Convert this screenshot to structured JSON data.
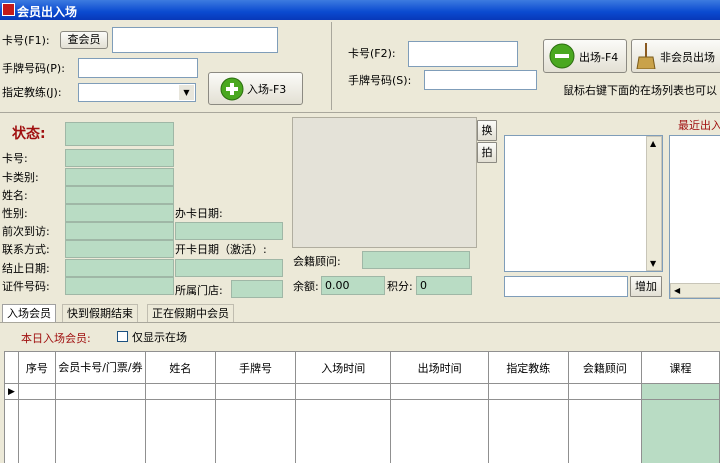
{
  "window": {
    "title": "会员出入场"
  },
  "entry": {
    "card_label": "卡号(F1):",
    "lookup_btn": "查会员",
    "card_value": "",
    "tag_label": "手牌号码(P):",
    "tag_value": "",
    "coach_label": "指定教练(J):",
    "coach_value": "",
    "enter_btn": "入场-F3"
  },
  "exit": {
    "card_label": "卡号(F2):",
    "card_value": "",
    "tag_label": "手牌号码(S):",
    "tag_value": "",
    "exit_btn": "出场-F4",
    "nonmember_btn": "非会员出场",
    "hint": "鼠标右键下面的在场列表也可以"
  },
  "status": {
    "title": "状态:",
    "fields": {
      "card_no": "卡号:",
      "card_type": "卡类别:",
      "name": "姓名:",
      "gender": "性别:",
      "last_visit": "前次到访:",
      "contact": "联系方式:",
      "end_date": "结止日期:",
      "id_no": "证件号码:",
      "issue_date": "办卡日期:",
      "activate_date": "开卡日期（激活）:",
      "store": "所属门店:"
    }
  },
  "photo": {
    "switch_btn": "换",
    "shoot_btn": "拍"
  },
  "account": {
    "advisor_label": "会籍顾问:",
    "balance_label": "余额:",
    "balance_value": "0.00",
    "points_label": "积分:",
    "points_value": "0"
  },
  "list_panel": {
    "add_btn": "增加"
  },
  "recent": {
    "title": "最近出入"
  },
  "tabs": [
    {
      "label": "入场会员",
      "active": true
    },
    {
      "label": "快到假期结束",
      "active": false
    },
    {
      "label": "正在假期中会员",
      "active": false
    }
  ],
  "today": {
    "label": "本日入场会员:",
    "checkbox_label": "仅显示在场",
    "checked": false
  },
  "table": {
    "columns": [
      "序号",
      "会员卡号/门票/券",
      "姓名",
      "手牌号",
      "入场时间",
      "出场时间",
      "指定教练",
      "会籍顾问",
      "课程"
    ],
    "row_marker": "▶"
  }
}
